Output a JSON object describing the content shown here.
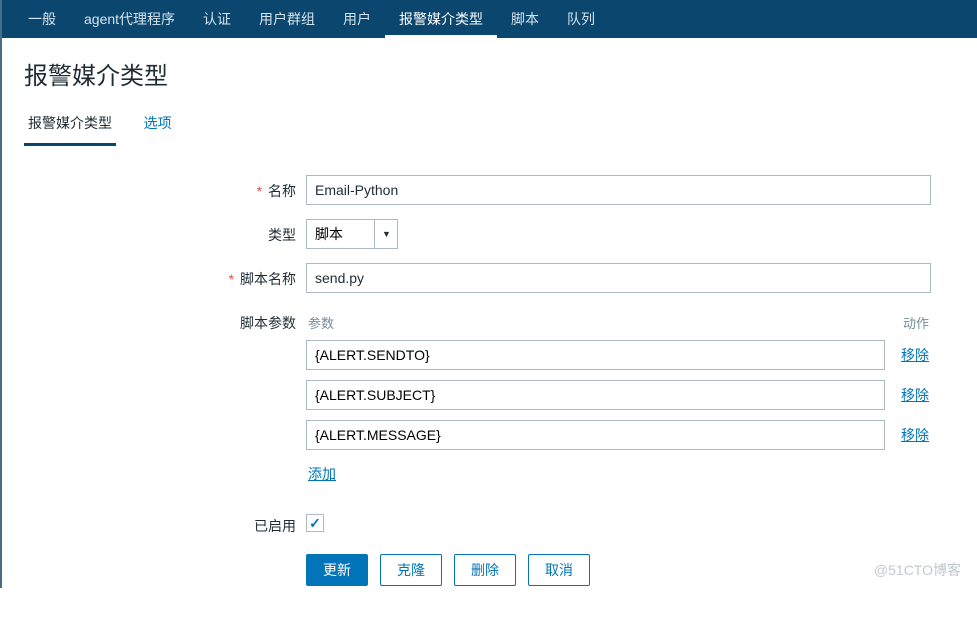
{
  "topNav": {
    "items": [
      {
        "label": "一般"
      },
      {
        "label": "agent代理程序"
      },
      {
        "label": "认证"
      },
      {
        "label": "用户群组"
      },
      {
        "label": "用户"
      },
      {
        "label": "报警媒介类型"
      },
      {
        "label": "脚本"
      },
      {
        "label": "队列"
      }
    ],
    "activeIndex": 5
  },
  "pageTitle": "报警媒介类型",
  "tabs": {
    "items": [
      {
        "label": "报警媒介类型"
      },
      {
        "label": "选项"
      }
    ],
    "activeIndex": 0
  },
  "form": {
    "name": {
      "label": "名称",
      "value": "Email-Python",
      "required": true
    },
    "type": {
      "label": "类型",
      "value": "脚本"
    },
    "scriptName": {
      "label": "脚本名称",
      "value": "send.py",
      "required": true
    },
    "scriptParams": {
      "label": "脚本参数",
      "headerParam": "参数",
      "headerAction": "动作",
      "removeLabel": "移除",
      "addLabel": "添加",
      "items": [
        {
          "value": "{ALERT.SENDTO}"
        },
        {
          "value": "{ALERT.SUBJECT}"
        },
        {
          "value": "{ALERT.MESSAGE}"
        }
      ]
    },
    "enabled": {
      "label": "已启用",
      "checked": true
    }
  },
  "buttons": {
    "update": "更新",
    "clone": "克隆",
    "delete": "删除",
    "cancel": "取消"
  },
  "watermark": "@51CTO博客"
}
